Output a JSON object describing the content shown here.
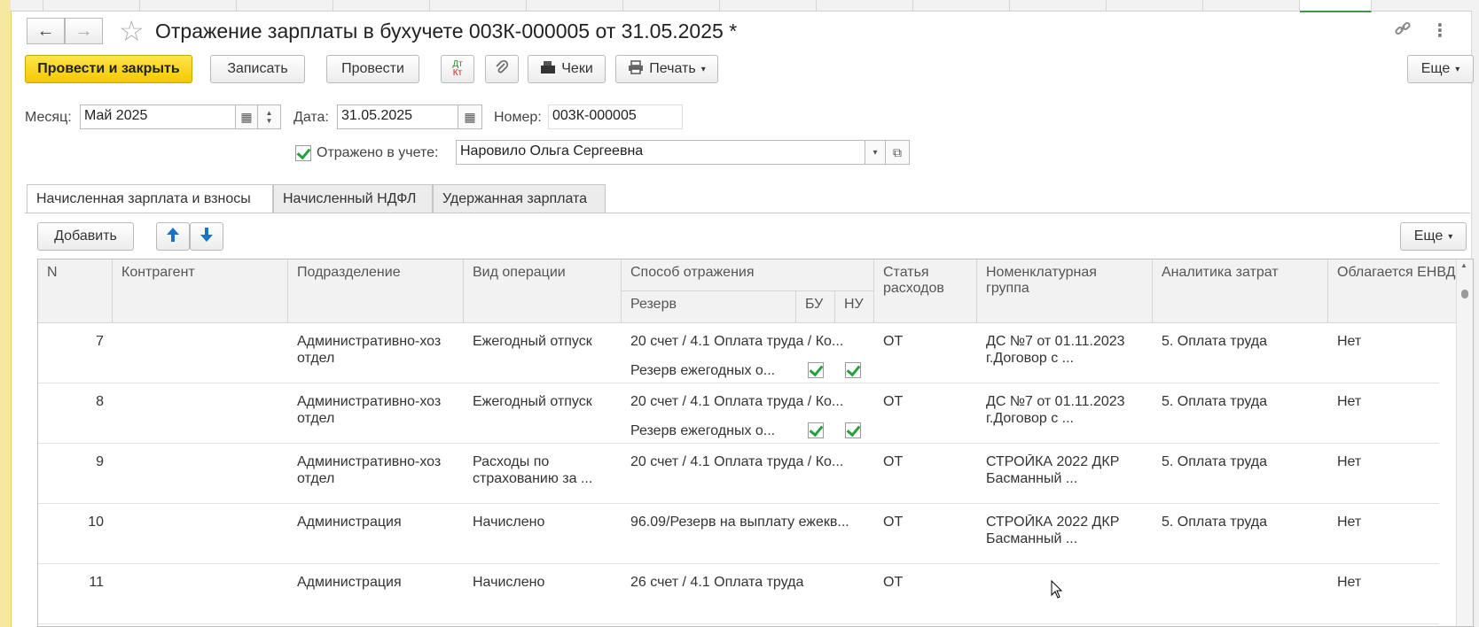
{
  "window": {
    "title": "Отражение зарплаты в бухучете 003К-000005 от 31.05.2025 *"
  },
  "toolbar": {
    "post_close": "Провести и закрыть",
    "save": "Записать",
    "post": "Провести",
    "dtkt_top": "Дт",
    "dtkt_bottom": "Кт",
    "receipts": "Чеки",
    "print": "Печать",
    "more": "Еще"
  },
  "form": {
    "month_label": "Месяц:",
    "month_value": "Май 2025",
    "date_label": "Дата:",
    "date_value": "31.05.2025",
    "number_label": "Номер:",
    "number_value": "003К-000005",
    "reflected_label": "Отражено в учете:",
    "reflected_checked": true,
    "responsible_value": "Наровило Ольга Сергеевна"
  },
  "tabs": [
    {
      "label": "Начисленная зарплата и взносы",
      "active": true
    },
    {
      "label": "Начисленный НДФЛ",
      "active": false
    },
    {
      "label": "Удержанная зарплата",
      "active": false
    }
  ],
  "table_toolbar": {
    "add": "Добавить",
    "more": "Еще"
  },
  "table": {
    "headers": {
      "n": "N",
      "counterparty": "Контрагент",
      "department": "Подразделение",
      "operation": "Вид операции",
      "method": "Способ отражения",
      "reserve": "Резерв",
      "bu": "БУ",
      "nu": "НУ",
      "expense_line1": "Статья",
      "expense_line2": "расходов",
      "nom_line1": "Номенклатурная",
      "nom_line2": "группа",
      "analytics": "Аналитика затрат",
      "envd": "Облагается ЕНВД"
    },
    "rows": [
      {
        "n": "7",
        "counterparty": "",
        "dept1": "Административно-хоз",
        "dept2": " отдел",
        "op1": "Ежегодный отпуск",
        "op2": "",
        "method": "20 счет / 4.1 Оплата труда / Ко...",
        "reserve": "Резерв ежегодных о...",
        "bu": true,
        "nu": true,
        "expense": "ОТ",
        "nom1": "ДС №7 от 01.11.2023",
        "nom2": "г.Договор с ...",
        "analytics": "5. Оплата труда",
        "envd": "Нет"
      },
      {
        "n": "8",
        "counterparty": "",
        "dept1": "Административно-хоз",
        "dept2": " отдел",
        "op1": "Ежегодный отпуск",
        "op2": "",
        "method": "20 счет / 4.1 Оплата труда / Ко...",
        "reserve": "Резерв ежегодных о...",
        "bu": true,
        "nu": true,
        "expense": "ОТ",
        "nom1": "ДС №7 от 01.11.2023",
        "nom2": "г.Договор с ...",
        "analytics": "5. Оплата труда",
        "envd": "Нет"
      },
      {
        "n": "9",
        "counterparty": "",
        "dept1": "Административно-хоз",
        "dept2": " отдел",
        "op1": "Расходы по",
        "op2": "страхованию за ...",
        "method": "20 счет / 4.1 Оплата труда / Ко...",
        "reserve": "",
        "bu": false,
        "nu": false,
        "expense": "ОТ",
        "nom1": "СТРОЙКА 2022 ДКР",
        "nom2": "Басманный ...",
        "analytics": "5. Оплата труда",
        "envd": "Нет"
      },
      {
        "n": "10",
        "counterparty": "",
        "dept1": "Администрация",
        "dept2": "",
        "op1": "Начислено",
        "op2": "",
        "method": "96.09/Резерв на выплату ежекв...",
        "reserve": "",
        "bu": false,
        "nu": false,
        "expense": "ОТ",
        "nom1": "СТРОЙКА 2022 ДКР",
        "nom2": "Басманный ...",
        "analytics": "5. Оплата труда",
        "envd": "Нет"
      },
      {
        "n": "11",
        "counterparty": "",
        "dept1": "Администрация",
        "dept2": "",
        "op1": "Начислено",
        "op2": "",
        "method": "26 счет / 4.1 Оплата труда",
        "reserve": "",
        "bu": false,
        "nu": false,
        "expense": "ОТ",
        "nom1": "",
        "nom2": "",
        "analytics": "",
        "envd": "Нет"
      }
    ]
  },
  "icons": {
    "back": "arrow-left-icon",
    "forward": "arrow-right-icon",
    "favorite": "star-icon",
    "link": "link-icon",
    "menu": "more-vert-icon",
    "attach": "paperclip-icon",
    "receipt": "cash-register-icon",
    "print": "printer-icon",
    "calendar": "calendar-icon",
    "up": "move-up-icon",
    "down": "move-down-icon"
  },
  "colors": {
    "primary_button": "#f5c800",
    "check_green": "#23a23b",
    "arrow_blue": "#1a73c8"
  }
}
